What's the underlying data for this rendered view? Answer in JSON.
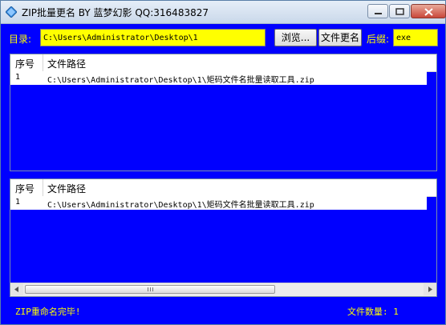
{
  "window": {
    "title": "ZIP批量更名 BY 蓝梦幻影 QQ:316483827",
    "icons": {
      "app": "diamond-app-icon",
      "minimize": "minimize-icon",
      "maximize": "maximize-icon",
      "close": "close-icon"
    }
  },
  "form": {
    "dir_label": "目录:",
    "dir_value": "C:\\Users\\Administrator\\Desktop\\1",
    "browse_label": "浏览...",
    "rename_label": "文件更名",
    "suffix_label": "后缀:",
    "suffix_value": "exe"
  },
  "list_before": {
    "columns": [
      "序号",
      "文件路径"
    ],
    "rows": [
      {
        "index": "1",
        "path": "C:\\Users\\Administrator\\Desktop\\1\\矩码文件名批量读取工具.zip"
      }
    ]
  },
  "list_after": {
    "columns": [
      "序号",
      "文件路径"
    ],
    "rows": [
      {
        "index": "1",
        "path": "C:\\Users\\Administrator\\Desktop\\1\\矩码文件名批量读取工具.zip"
      }
    ],
    "scrollbar": {
      "left_arrow": "scroll-left-icon",
      "right_arrow": "scroll-right-icon"
    }
  },
  "status": {
    "message": "ZIP重命名完毕!",
    "count_text": "文件数量: 1"
  },
  "colors": {
    "background": "#0000ff",
    "accent": "#ffff00"
  }
}
